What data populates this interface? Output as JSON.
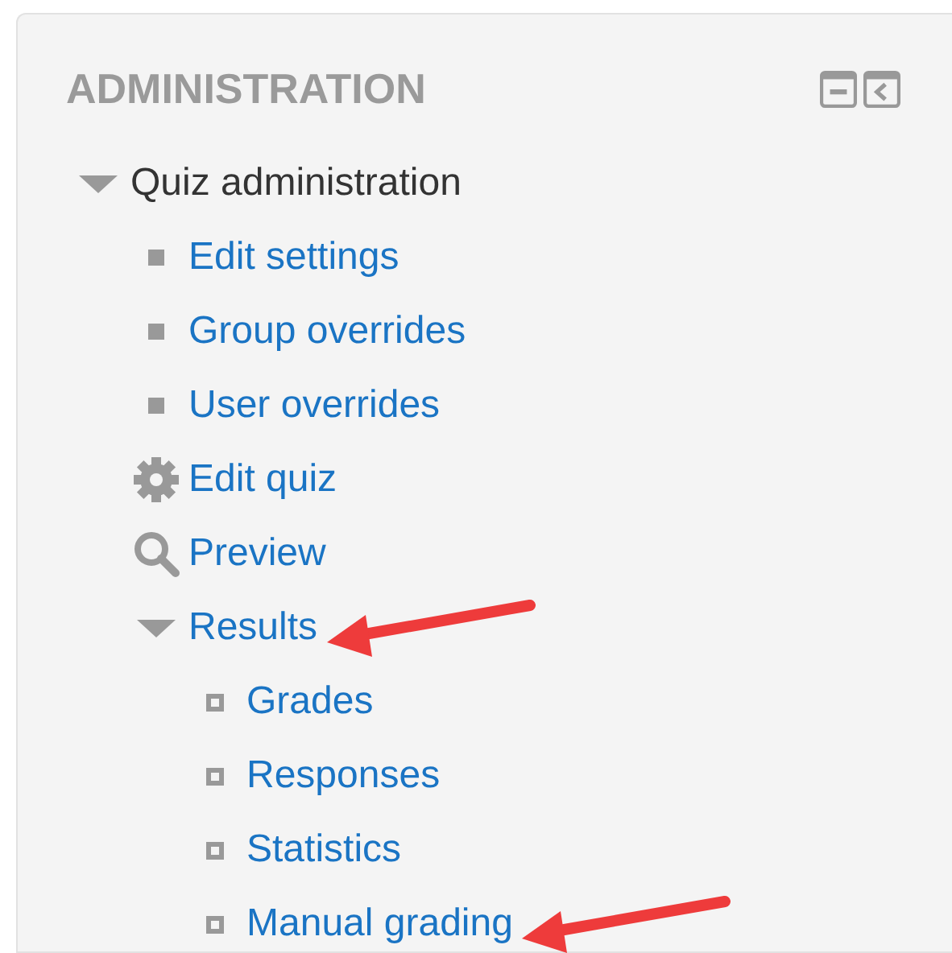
{
  "block": {
    "title": "ADMINISTRATION",
    "controls": [
      {
        "kind": "minimize"
      },
      {
        "kind": "dock"
      }
    ],
    "items": [
      {
        "label": "Quiz administration",
        "kind": "category",
        "expanded": true,
        "annotated": false,
        "children": [
          {
            "label": "Edit settings",
            "kind": "node",
            "annotated": false
          },
          {
            "label": "Group overrides",
            "kind": "node",
            "annotated": false
          },
          {
            "label": "User overrides",
            "kind": "node",
            "annotated": false
          },
          {
            "label": "Edit quiz",
            "kind": "gear",
            "annotated": false
          },
          {
            "label": "Preview",
            "kind": "search",
            "annotated": false
          },
          {
            "label": "Results",
            "kind": "branch",
            "expanded": true,
            "annotated": true,
            "children": [
              {
                "label": "Grades",
                "kind": "report",
                "annotated": false
              },
              {
                "label": "Responses",
                "kind": "report",
                "annotated": false
              },
              {
                "label": "Statistics",
                "kind": "report",
                "annotated": false
              },
              {
                "label": "Manual grading",
                "kind": "report",
                "annotated": true
              }
            ]
          }
        ]
      }
    ]
  }
}
